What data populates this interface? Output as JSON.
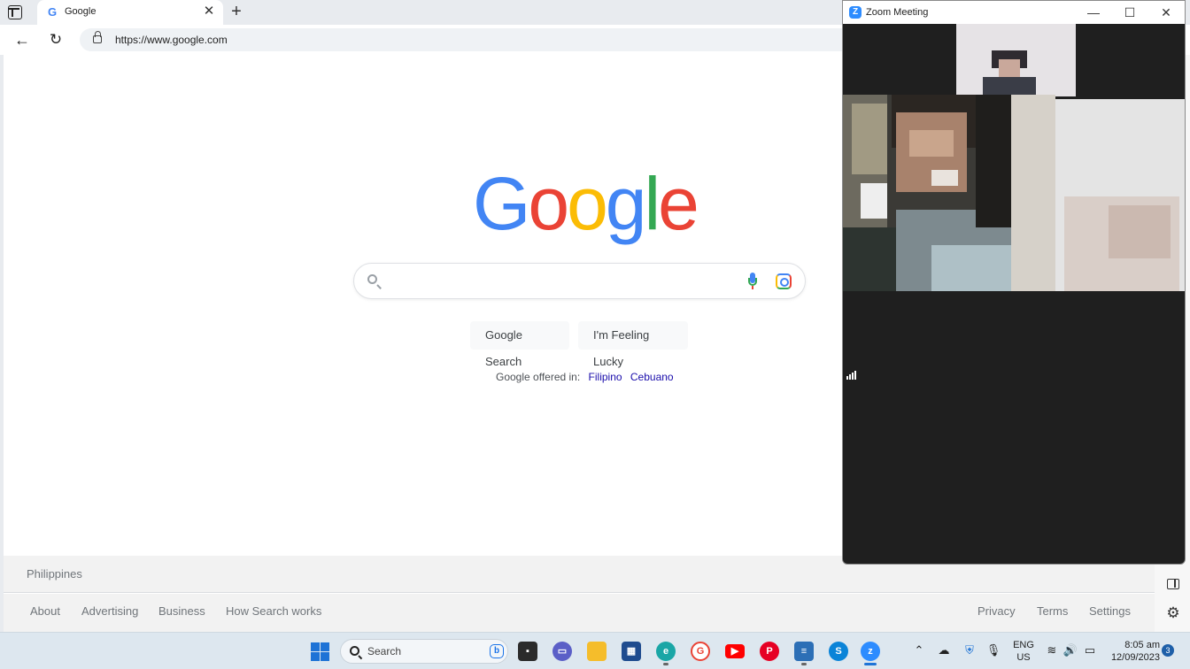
{
  "browser": {
    "tab_title": "Google",
    "tab_favicon": "G",
    "url": "https://www.google.com"
  },
  "google": {
    "logo_letters": [
      "G",
      "o",
      "o",
      "g",
      "l",
      "e"
    ],
    "logo_colors": [
      "#4285f4",
      "#ea4335",
      "#fbbc05",
      "#4285f4",
      "#34a853",
      "#ea4335"
    ],
    "search_placeholder": "",
    "search_button": "Google Search",
    "lucky_button": "I'm Feeling Lucky",
    "offered_in_label": "Google offered in:",
    "languages": [
      "Filipino",
      "Cebuano"
    ]
  },
  "footer": {
    "country": "Philippines",
    "left_links": [
      "About",
      "Advertising",
      "Business",
      "How Search works"
    ],
    "right_links": [
      "Privacy",
      "Terms",
      "Settings"
    ]
  },
  "zoom": {
    "title": "Zoom Meeting",
    "logo_glyph": "Z",
    "brand_color": "#2d8cff"
  },
  "taskbar": {
    "search_label": "Search",
    "lang_line1": "ENG",
    "lang_line2": "US",
    "time": "8:05 am",
    "date": "12/09/2023",
    "notification_count": "3",
    "apps": [
      "file-explorer-dark",
      "teams-chat",
      "file-explorer",
      "microsoft-store",
      "edge",
      "grammarly",
      "youtube",
      "pinterest",
      "notepad",
      "skype",
      "zoom"
    ]
  }
}
